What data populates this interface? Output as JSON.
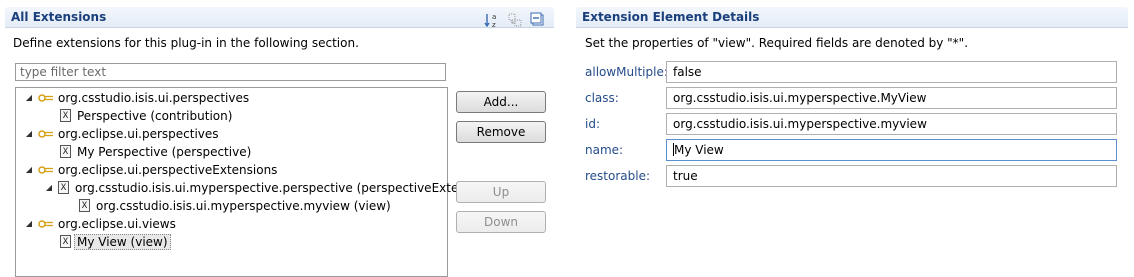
{
  "left_panel": {
    "title": "All Extensions",
    "description": "Define extensions for this plug-in in the following section.",
    "filter_placeholder": "type filter text",
    "tree": [
      {
        "label": "org.csstudio.isis.ui.perspectives"
      },
      {
        "label": "Perspective (contribution)"
      },
      {
        "label": "org.eclipse.ui.perspectives"
      },
      {
        "label": "My Perspective (perspective)"
      },
      {
        "label": "org.eclipse.ui.perspectiveExtensions"
      },
      {
        "label": "org.csstudio.isis.ui.myperspective.perspective (perspectiveExtension)"
      },
      {
        "label": "org.csstudio.isis.ui.myperspective.myview (view)"
      },
      {
        "label": "org.eclipse.ui.views"
      },
      {
        "label": "My View (view)"
      }
    ],
    "buttons": {
      "add": "Add...",
      "remove": "Remove",
      "up": "Up",
      "down": "Down"
    }
  },
  "right_panel": {
    "title": "Extension Element Details",
    "description": "Set the properties of \"view\". Required fields are denoted by \"*\".",
    "fields": [
      {
        "label": "allowMultiple:",
        "value": "false"
      },
      {
        "label": "class:",
        "value": "org.csstudio.isis.ui.myperspective.MyView"
      },
      {
        "label": "id:",
        "value": "org.csstudio.isis.ui.myperspective.myview"
      },
      {
        "label": "name:",
        "value": "My View"
      },
      {
        "label": "restorable:",
        "value": "true"
      }
    ]
  },
  "colors": {
    "header_title": "#1a3f7a",
    "field_label": "#254c8a",
    "extension_icon": "#d4a017"
  },
  "icons": [
    "sort-alphabetical-icon",
    "toggle-icon",
    "collapse-all-icon",
    "twisty-expanded-icon",
    "extension-point-icon",
    "xml-element-icon"
  ]
}
